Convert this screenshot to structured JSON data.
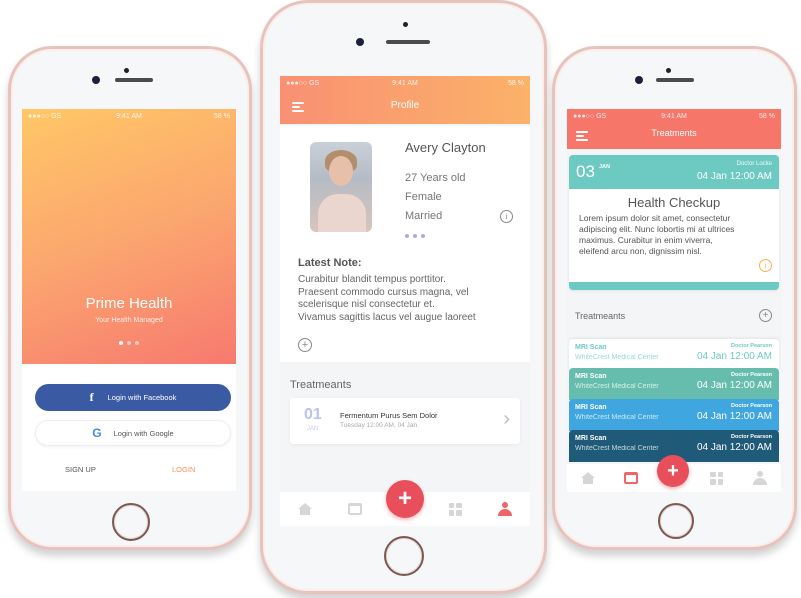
{
  "status_bar": {
    "carrier": "●●●○○ GS",
    "time": "9:41 AM",
    "battery": "58 %"
  },
  "login_screen": {
    "brand": "Prime Health",
    "tagline": "Your Health Managed",
    "pager_count": 3,
    "pager_active": 0,
    "facebook_button": "Login with Facebook",
    "facebook_icon": "f",
    "google_button": "Login with Google",
    "google_icon": "G",
    "signup_link": "SIGN UP",
    "login_link": "LOGIN",
    "colors": {
      "facebook": "#3a5aa3",
      "login_link": "#f5925d"
    }
  },
  "profile_screen": {
    "title": "Profile",
    "name": "Avery Clayton",
    "age": "27 Years old",
    "gender": "Female",
    "marital_status": "Married",
    "info_icon": "i",
    "latest_note_title": "Latest Note:",
    "latest_note_lines": [
      "Curabitur blandit tempus porttitor.",
      "Praesent commodo cursus magna, vel",
      "scelerisque nisl consectetur et.",
      "Vivamus sagittis lacus vel augue laoreet"
    ],
    "add_note_icon": "+",
    "treatments_title": "Treatmeants",
    "treatment": {
      "day": "01",
      "month": "JAN",
      "title": "Fermentum Purus Sem Dolor",
      "subtitle": "Tuesday 12:00 AM, 04 Jan",
      "chevron": "›"
    },
    "tabbar": {
      "items": [
        "home",
        "calendar",
        "add",
        "grid",
        "profile"
      ],
      "active": "profile",
      "fab_label": "+"
    }
  },
  "treatments_screen": {
    "title": "Treatments",
    "checkup": {
      "day": "03",
      "month": "JAN",
      "doctor": "Doctor Locke",
      "datetime": "04 Jan 12:00 AM",
      "title": "Health Checkup",
      "body_lines": [
        "Lorem ipsum dolor sit amet, consectetur",
        "adipiscing elit. Nunc lobortis mi at ultrices",
        "maximus. Curabitur in enim viverra,",
        "eleifend arcu non, dignissim nisl."
      ],
      "info_icon": "i"
    },
    "treatments_title": "Treatmeants",
    "add_icon": "+",
    "items": [
      {
        "title": "MRI Scan",
        "location": "WhiteCrest Medical Center",
        "doctor": "Doctor Pearson",
        "datetime": "04 Jan 12:00 AM",
        "bg": "#ffffff",
        "fg": "#6dcac2"
      },
      {
        "title": "MRI Scan",
        "location": "WhiteCrest Medical Center",
        "doctor": "Doctor Pearson",
        "datetime": "04 Jan 12:00 AM",
        "bg": "#66bdae",
        "fg": "#ffffff"
      },
      {
        "title": "MRI Scan",
        "location": "WhiteCrest Medical Center",
        "doctor": "Doctor Pearson",
        "datetime": "04 Jan 12:00 AM",
        "bg": "#3fa6e0",
        "fg": "#ffffff"
      },
      {
        "title": "MRI Scan",
        "location": "WhiteCrest Medical Center",
        "doctor": "Doctor Pearson",
        "datetime": "04 Jan 12:00 AM",
        "bg": "#1f5a78",
        "fg": "#ffffff"
      }
    ],
    "tabbar": {
      "items": [
        "home",
        "calendar",
        "add",
        "grid",
        "profile"
      ],
      "active": "calendar",
      "fab_label": "+"
    }
  },
  "colors": {
    "fab": "#e94f5a",
    "teal": "#6dcac2",
    "coral_header": "#f6766a",
    "active_tab": "#f0656a",
    "inactive_tab": "#d6d6d6"
  }
}
